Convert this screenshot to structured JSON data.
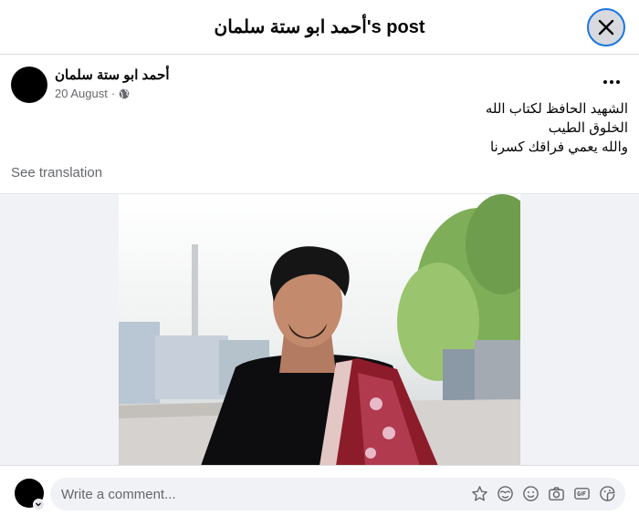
{
  "header": {
    "title": "أحمد ابو ستة سلمان's post"
  },
  "post": {
    "author": "أحمد ابو ستة سلمان",
    "date": "20 August",
    "separator": "·",
    "audience_icon": "globe-icon",
    "lines": [
      "الشهيد الحافظ لكتاب الله",
      "الخلوق الطيب",
      "والله يعمي فراقك كسرنا"
    ],
    "see_translation": "See translation"
  },
  "comment": {
    "placeholder": "Write a comment...",
    "icons": [
      "avatar-sticker-icon",
      "emoji-face-icon",
      "smiley-icon",
      "camera-icon",
      "gif-icon",
      "sticker-icon"
    ]
  },
  "colors": {
    "accent": "#1b74e4",
    "secondary_text": "#65676b",
    "background_gray": "#f0f2f5"
  }
}
